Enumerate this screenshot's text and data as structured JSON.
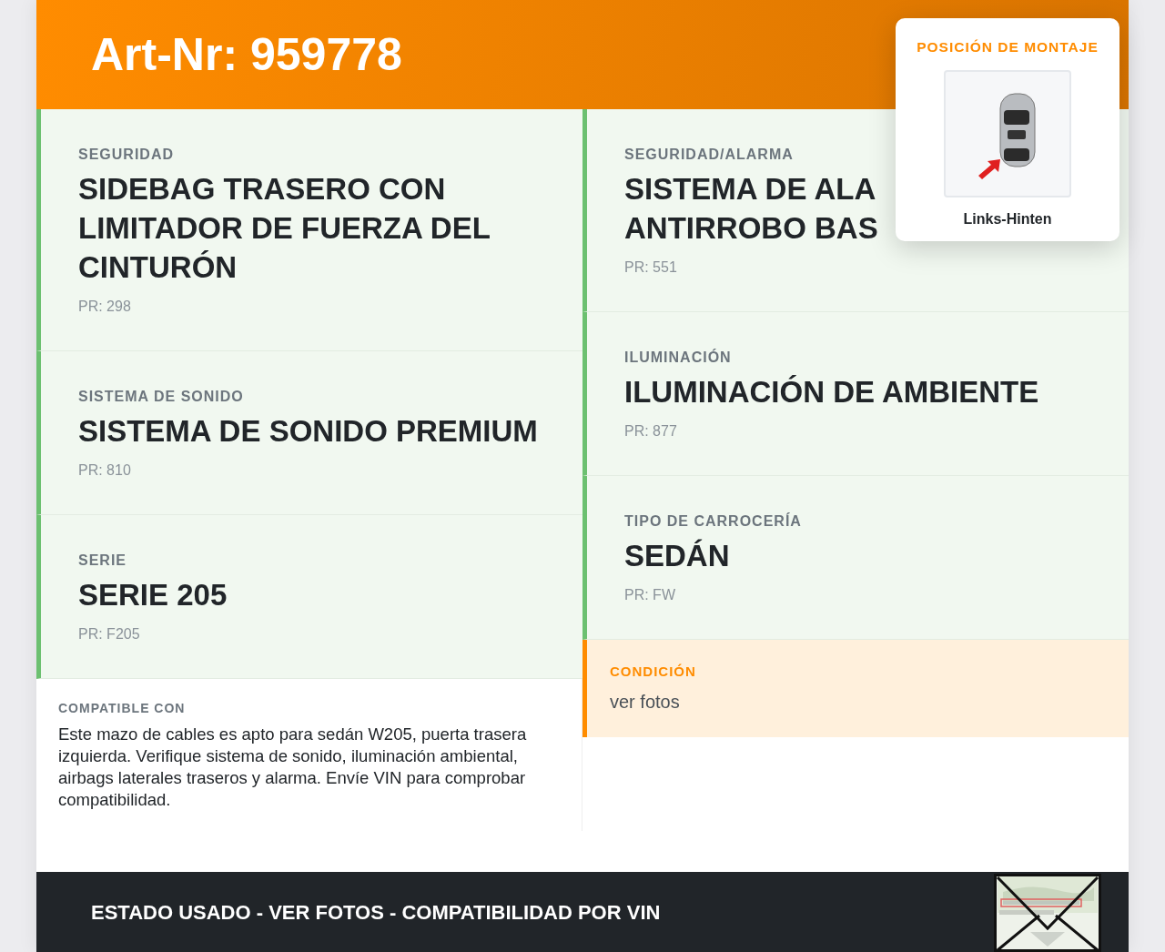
{
  "header": {
    "title": "Art-Nr: 959778"
  },
  "left_features": [
    {
      "kind": "feature",
      "category": "SEGURIDAD",
      "title_lines": [
        "SIDEBAG TRASERO CON LIMITADOR DE FUERZA DEL CINTURÓN"
      ],
      "pr": "PR: 298"
    },
    {
      "kind": "feature",
      "category": "SISTEMA DE SONIDO",
      "title_lines": [
        "SISTEMA DE SONIDO PREMIUM"
      ],
      "pr": "PR: 810"
    },
    {
      "kind": "feature",
      "category": "SERIE",
      "title_lines": [
        "SERIE 205"
      ],
      "pr": "PR: F205"
    }
  ],
  "right_features": [
    {
      "kind": "feature",
      "category": "SEGURIDAD/ALARMA",
      "title_lines": [
        "SISTEMA DE ALA",
        "ANTIRROBO BAS"
      ],
      "pr": "PR: 551"
    },
    {
      "kind": "feature",
      "category": "ILUMINACIÓN",
      "title_lines": [
        "ILUMINACIÓN DE AMBIENTE"
      ],
      "pr": "PR: 877"
    },
    {
      "kind": "feature",
      "category": "TIPO DE CARROCERÍA",
      "title_lines": [
        "SEDÁN"
      ],
      "pr": "PR: FW"
    },
    {
      "kind": "condition",
      "category": "CONDICIÓN",
      "value": "ver fotos"
    }
  ],
  "compatible": {
    "label": "COMPATIBLE CON",
    "text": "Este mazo de cables es apto para sedán W205, puerta trasera izquierda. Verifique sistema de sonido, iluminación ambiental, airbags laterales traseros y alarma. Envíe VIN para comprobar compatibilidad."
  },
  "footer": {
    "text": "ESTADO USADO - VER FOTOS - COMPATIBILIDAD POR VIN"
  },
  "mounting_popup": {
    "title": "POSICIÓN DE MONTAJE",
    "position": "Links-Hinten"
  }
}
